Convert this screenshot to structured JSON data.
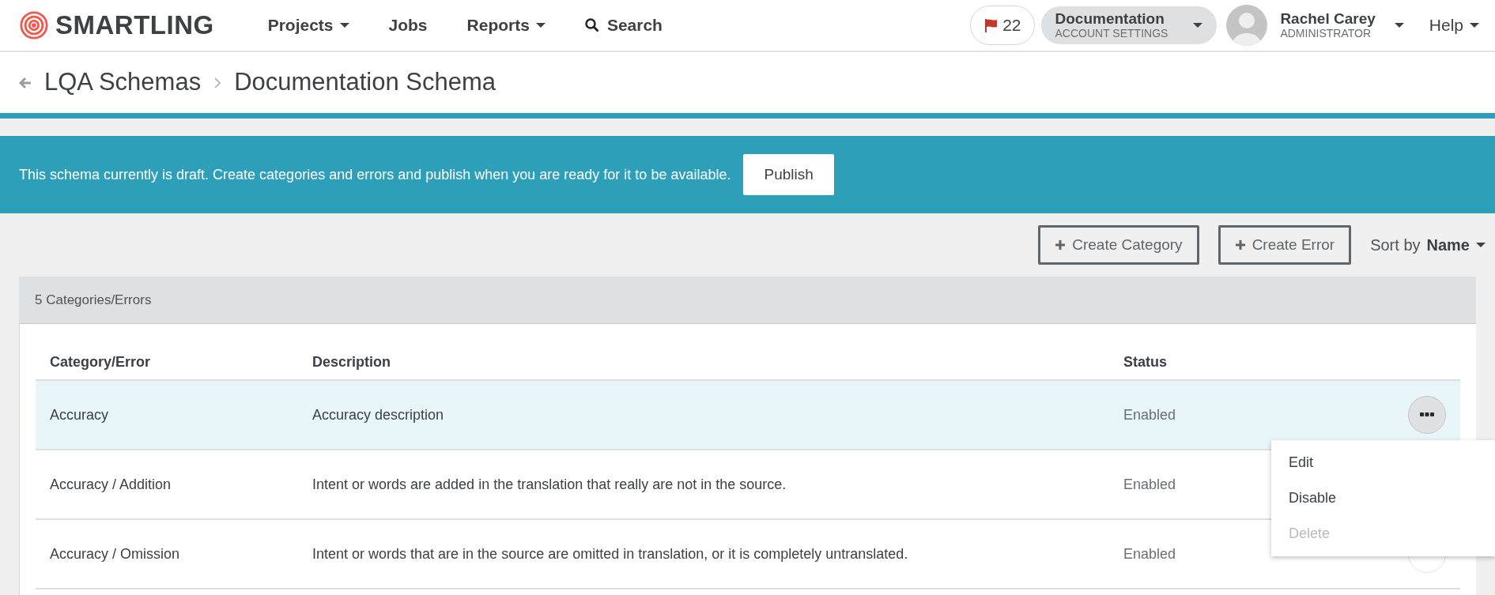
{
  "brand": {
    "name": "SMARTLING"
  },
  "nav": [
    {
      "label": "Projects",
      "dropdown": true
    },
    {
      "label": "Jobs",
      "dropdown": false
    },
    {
      "label": "Reports",
      "dropdown": true
    },
    {
      "label": "Search",
      "kind": "search"
    }
  ],
  "notifications": {
    "count": "22"
  },
  "account": {
    "name": "Documentation",
    "subtitle": "ACCOUNT SETTINGS"
  },
  "user": {
    "name": "Rachel Carey",
    "role": "ADMINISTRATOR"
  },
  "help": {
    "label": "Help"
  },
  "breadcrumb": [
    {
      "label": "LQA Schemas"
    },
    {
      "label": "Documentation Schema"
    }
  ],
  "banner": {
    "message": "This schema currently is draft. Create categories and errors and publish when you are ready for it to be available.",
    "button": "Publish"
  },
  "toolbar": {
    "buttons": [
      "Create Category",
      "Create Error"
    ],
    "sort_label": "Sort by",
    "sort_value": "Name"
  },
  "panel": {
    "title": "5 Categories/Errors"
  },
  "table": {
    "columns": [
      "Category/Error",
      "Description",
      "Status"
    ],
    "rows": [
      {
        "name": "Accuracy",
        "description": "Accuracy description",
        "status": "Enabled",
        "selected": true,
        "actions": true,
        "menu_open": true
      },
      {
        "name": "Accuracy / Addition",
        "description": "Intent or words are added in the translation that really are not in the source.",
        "status": "Enabled",
        "selected": false,
        "actions": false,
        "menu_open": false
      },
      {
        "name": "Accuracy / Omission",
        "description": "Intent or words that are in the source are omitted in translation, or it is completely untranslated.",
        "status": "Enabled",
        "selected": false,
        "actions": true,
        "menu_open": false
      }
    ]
  },
  "menu": [
    {
      "label": "Edit",
      "disabled": false
    },
    {
      "label": "Disable",
      "disabled": false
    },
    {
      "label": "Delete",
      "disabled": true
    }
  ]
}
